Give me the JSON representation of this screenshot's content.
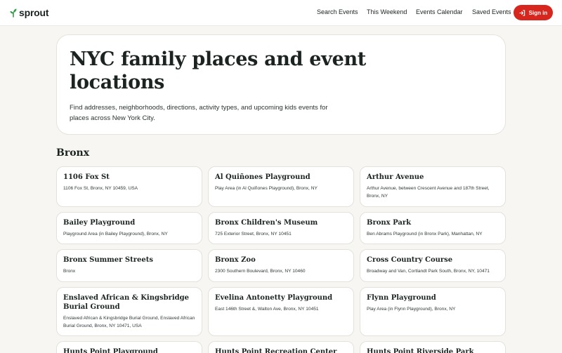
{
  "header": {
    "logo_text": "sprout",
    "nav": [
      "Search Events",
      "This Weekend",
      "Events Calendar",
      "Saved Events"
    ],
    "signin_label": "Sign in",
    "accent": "#d7261e",
    "logo_leaf_color": "#2f9e44"
  },
  "hero": {
    "title": "NYC family places and event locations",
    "description": "Find addresses, neighborhoods, directions, activity types, and upcoming kids events for places across New York City."
  },
  "section": {
    "title": "Bronx"
  },
  "places": [
    {
      "name": "1106 Fox St",
      "address": "1106 Fox St, Bronx, NY 10459, USA"
    },
    {
      "name": "Al Quiñones Playground",
      "address": "Play Area (in Al Quiñones Playground), Bronx, NY"
    },
    {
      "name": "Arthur Avenue",
      "address": "Arthur Avenue, between Crescent Avenue and 187th Street, Bronx, NY"
    },
    {
      "name": "Bailey Playground",
      "address": "Playground Area (in Bailey Playground), Bronx, NY"
    },
    {
      "name": "Bronx Children's Museum",
      "address": "725 Exterior Street, Bronx, NY 10451"
    },
    {
      "name": "Bronx Park",
      "address": "Ben Abrams Playground (in Bronx Park), Manhattan, NY"
    },
    {
      "name": "Bronx Summer Streets",
      "address": "Bronx"
    },
    {
      "name": "Bronx Zoo",
      "address": "2300 Southern Boulevard, Bronx, NY 10460"
    },
    {
      "name": "Cross Country Course",
      "address": "Broadway and Van, Cortlandt Park South, Bronx, NY, 10471"
    },
    {
      "name": "Enslaved African & Kingsbridge Burial Ground",
      "address": "Enslaved African & Kingsbridge Burial Ground, Enslaved African Burial Ground, Bronx, NY 10471, USA"
    },
    {
      "name": "Evelina Antonetty Playground",
      "address": "East 146th Street &, Walton Ave, Bronx, NY 10451"
    },
    {
      "name": "Flynn Playground",
      "address": "Play Area (in Flynn Playground), Bronx, NY"
    },
    {
      "name": "Hunts Point Playground",
      "address": ""
    },
    {
      "name": "Hunts Point Recreation Center",
      "address": ""
    },
    {
      "name": "Hunts Point Riverside Park",
      "address": ""
    }
  ]
}
